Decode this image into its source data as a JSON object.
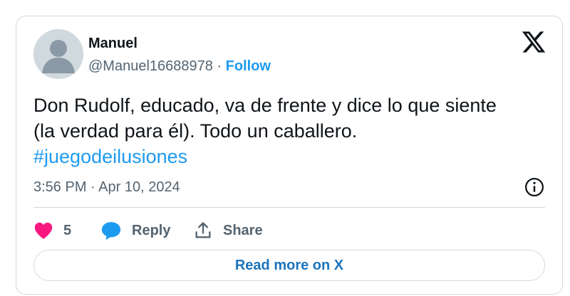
{
  "author": {
    "display_name": "Manuel",
    "handle": "@Manuel16688978",
    "separator": " · ",
    "follow_label": "Follow",
    "avatar_icon": "default-avatar-icon"
  },
  "brand": {
    "logo_icon": "x-logo-icon"
  },
  "tweet": {
    "text_line1": "Don Rudolf, educado, va de frente y dice lo que siente",
    "text_line2": "(la verdad para él). Todo un caballero.",
    "hashtag": "#juegodeilusiones",
    "timestamp": "3:56 PM · Apr 10, 2024",
    "info_icon": "info-icon"
  },
  "actions": {
    "like_count": "5",
    "reply_label": "Reply",
    "share_label": "Share"
  },
  "read_more_label": "Read more on X",
  "colors": {
    "accent": "#1d9bf0",
    "like": "#f91880",
    "text": "#0f1419",
    "muted": "#536471",
    "border": "#cfd9de"
  }
}
